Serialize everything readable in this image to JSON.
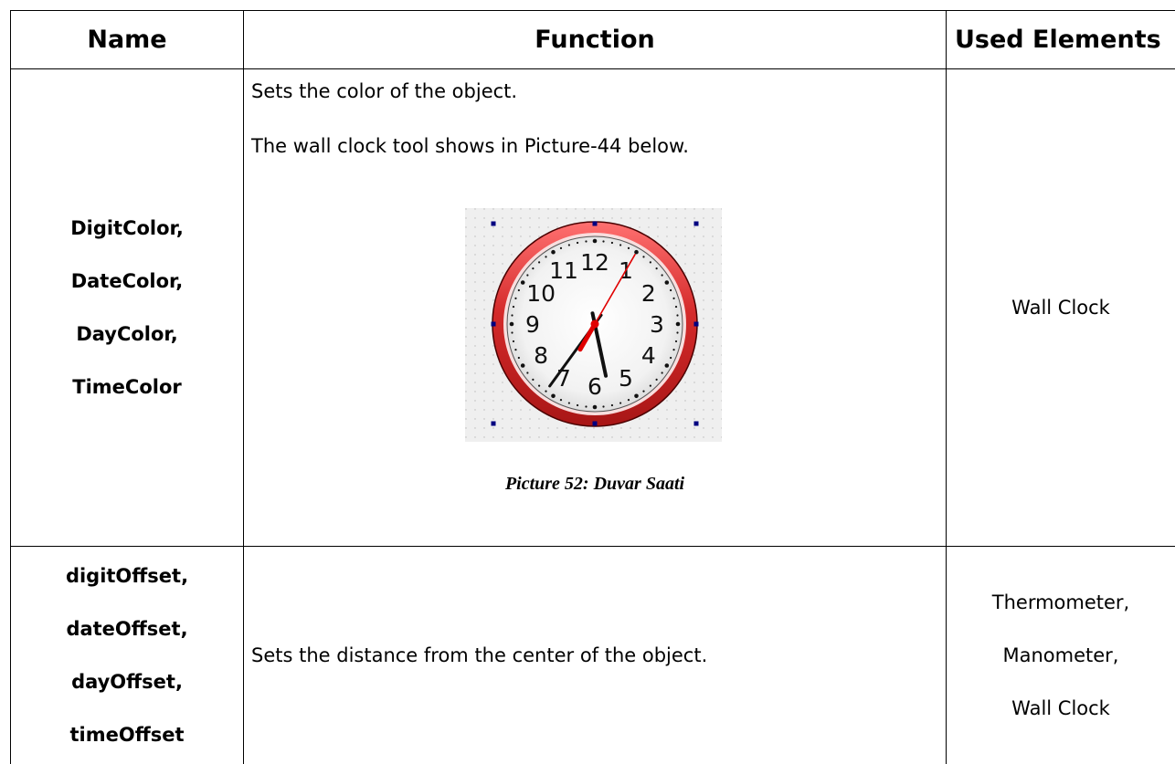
{
  "table": {
    "headers": {
      "name": "Name",
      "function": "Function",
      "used_elements": "Used Elements"
    },
    "rows": [
      {
        "names": [
          "DigitColor,",
          "DateColor,",
          "DayColor,",
          "TimeColor"
        ],
        "function_lines": [
          "Sets the color of the object.",
          "The wall clock tool shows in Picture-44 below."
        ],
        "figure": {
          "caption": "Picture 52: Duvar Saati",
          "clock_numbers": [
            "12",
            "1",
            "2",
            "3",
            "4",
            "5",
            "6",
            "7",
            "8",
            "9",
            "10",
            "11"
          ],
          "time": {
            "hour": 5,
            "minute": 36,
            "second": 5
          },
          "colors": {
            "bezel": "#d42a2a",
            "second_hand": "#e00000",
            "hands": "#111111",
            "handle": "#000080"
          }
        },
        "used_elements": [
          "Wall Clock"
        ]
      },
      {
        "names": [
          "digitOffset,",
          "dateOffset,",
          "dayOffset,",
          "timeOffset"
        ],
        "function_lines": [
          "Sets the distance from the center of the object."
        ],
        "used_elements": [
          "Thermometer,",
          "Manometer,",
          "Wall Clock"
        ]
      }
    ]
  }
}
